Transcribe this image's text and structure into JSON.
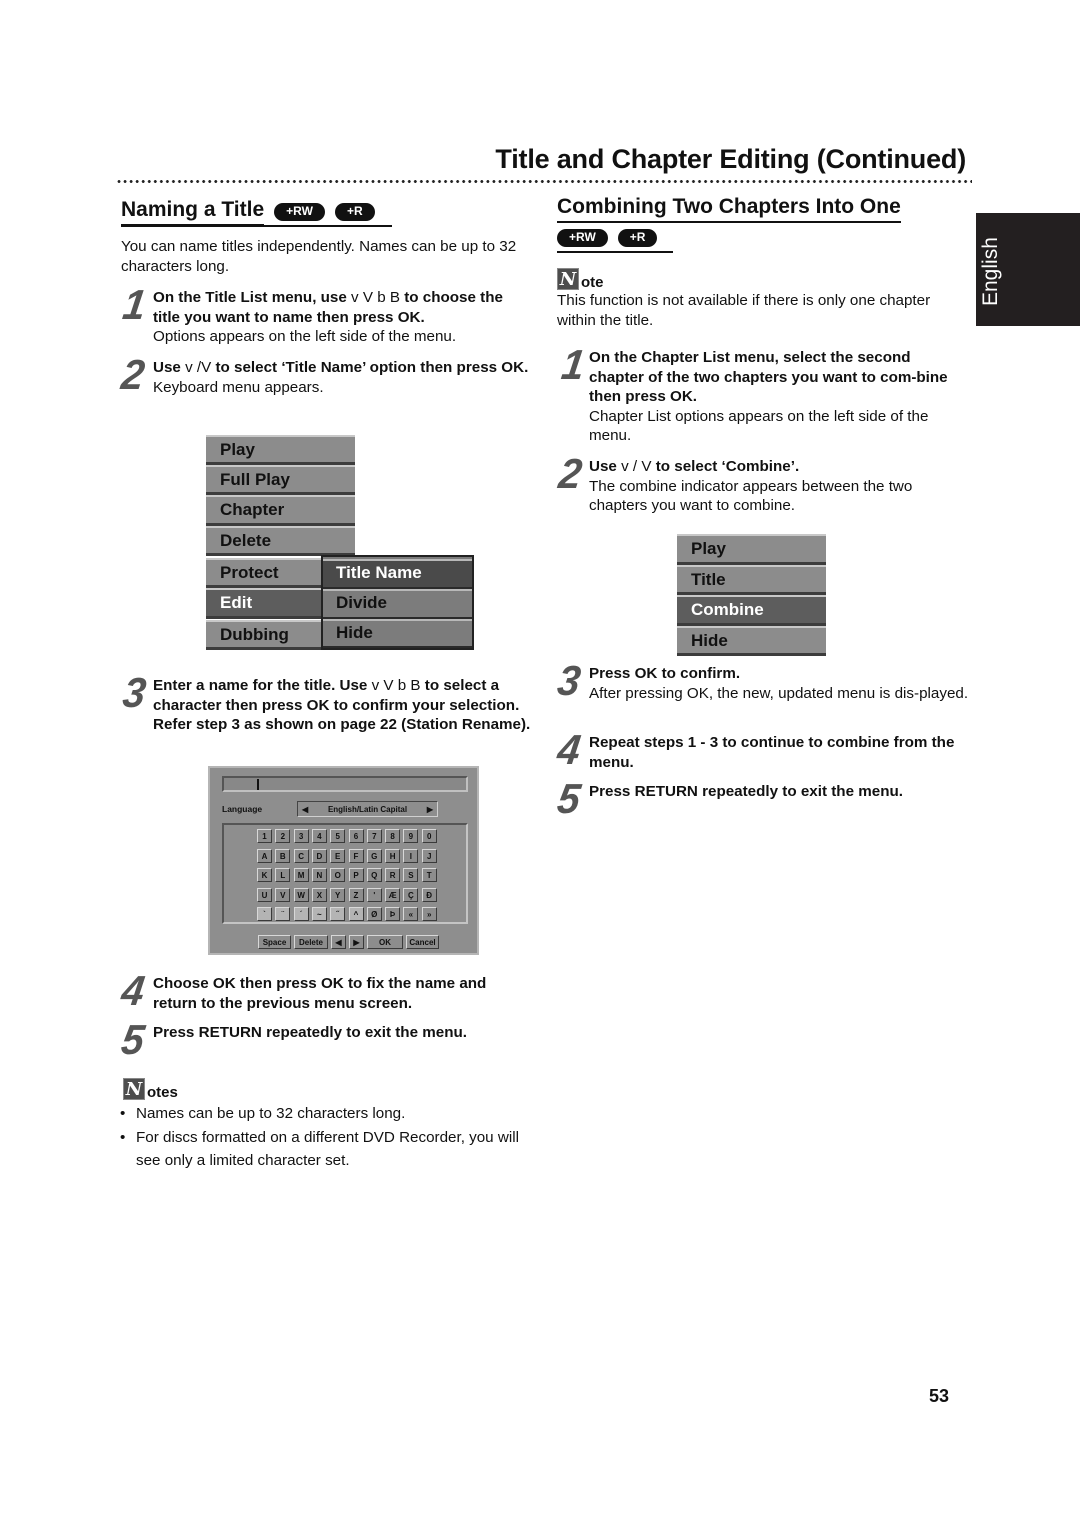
{
  "header": {
    "page_title": "Title and Chapter Editing (Continued)"
  },
  "side_tab": {
    "label": "English"
  },
  "page_number": "53",
  "left": {
    "heading": "Naming a Title",
    "badges": [
      "+RW",
      "+R"
    ],
    "intro": "You can name titles independently. Names can be up to 32 characters long.",
    "steps": [
      {
        "num": "1",
        "bold_parts": [
          "On the Title List menu, use ",
          " to choose the title you want to name then press OK."
        ],
        "arrows": "v  V  b  B",
        "normal": "Options appears on the left side of the menu."
      },
      {
        "num": "2",
        "bold_parts": [
          "Use ",
          " to select ‘Title Name’ option then press OK."
        ],
        "arrows": "v /V",
        "normal": "Keyboard menu appears."
      },
      {
        "num": "3",
        "bold_parts": [
          "Enter a name for the title. Use ",
          " to select a character then press OK to confirm your selection. Refer step 3 as shown on page 22 (Station Rename)."
        ],
        "arrows": "v  V  b  B",
        "normal": ""
      },
      {
        "num": "4",
        "bold": "Choose OK then press OK to fix the name and return to the previous menu screen."
      },
      {
        "num": "5",
        "bold": "Press RETURN repeatedly to exit the menu."
      }
    ],
    "options_menu": {
      "items": [
        "Play",
        "Full Play",
        "Chapter",
        "Delete",
        "Protect",
        "Edit",
        "Dubbing"
      ],
      "selected": "Edit",
      "submenu": [
        "Title Name",
        "Divide",
        "Hide"
      ],
      "submenu_selected": "Title Name"
    },
    "keyboard": {
      "input_value": "",
      "language_label": "Language",
      "language_value": "English/Latin Capital",
      "rows": [
        [
          "1",
          "2",
          "3",
          "4",
          "5",
          "6",
          "7",
          "8",
          "9",
          "0"
        ],
        [
          "A",
          "B",
          "C",
          "D",
          "E",
          "F",
          "G",
          "H",
          "I",
          "J"
        ],
        [
          "K",
          "L",
          "M",
          "N",
          "O",
          "P",
          "Q",
          "R",
          "S",
          "T"
        ],
        [
          "U",
          "V",
          "W",
          "X",
          "Y",
          "Z",
          "'",
          "Æ",
          "Ç",
          "Đ"
        ],
        [
          "`",
          "¨",
          "´",
          "~",
          "˝",
          "^",
          "Ø",
          "Þ",
          "«",
          "»"
        ]
      ],
      "buttons": {
        "space": "Space",
        "delete": "Delete",
        "left": "◀",
        "right": "▶",
        "ok": "OK",
        "cancel": "Cancel"
      }
    },
    "notes": {
      "icon_letter": "N",
      "heading_rest": "otes",
      "items": [
        "Names can be up to 32 characters long.",
        "For discs formatted on a different DVD Recorder, you will see only a limited character set."
      ]
    }
  },
  "right": {
    "heading": "Combining Two Chapters Into One",
    "badges": [
      "+RW",
      "+R"
    ],
    "note": {
      "icon_letter": "N",
      "heading_rest": "ote",
      "text": "This function is not available if there is only one chapter within the title."
    },
    "steps": [
      {
        "num": "1",
        "bold": "On the Chapter List menu, select the second chapter of the two chapters you want to com-bine then press OK.",
        "normal": "Chapter List options appears on the left side of the menu."
      },
      {
        "num": "2",
        "bold_parts": [
          "Use ",
          " to select ‘Combine’."
        ],
        "arrows": "v  / V",
        "normal": "The combine indicator appears between the two chapters you want to combine."
      },
      {
        "num": "3",
        "bold": "Press OK to confirm.",
        "normal": "After pressing OK, the new, updated menu is dis-played."
      },
      {
        "num": "4",
        "bold": "Repeat steps 1 - 3 to continue to combine from the menu."
      },
      {
        "num": "5",
        "bold": "Press RETURN repeatedly to exit the menu."
      }
    ],
    "chapter_menu": {
      "items": [
        "Play",
        "Title",
        "Combine",
        "Hide"
      ],
      "selected": "Combine"
    }
  }
}
